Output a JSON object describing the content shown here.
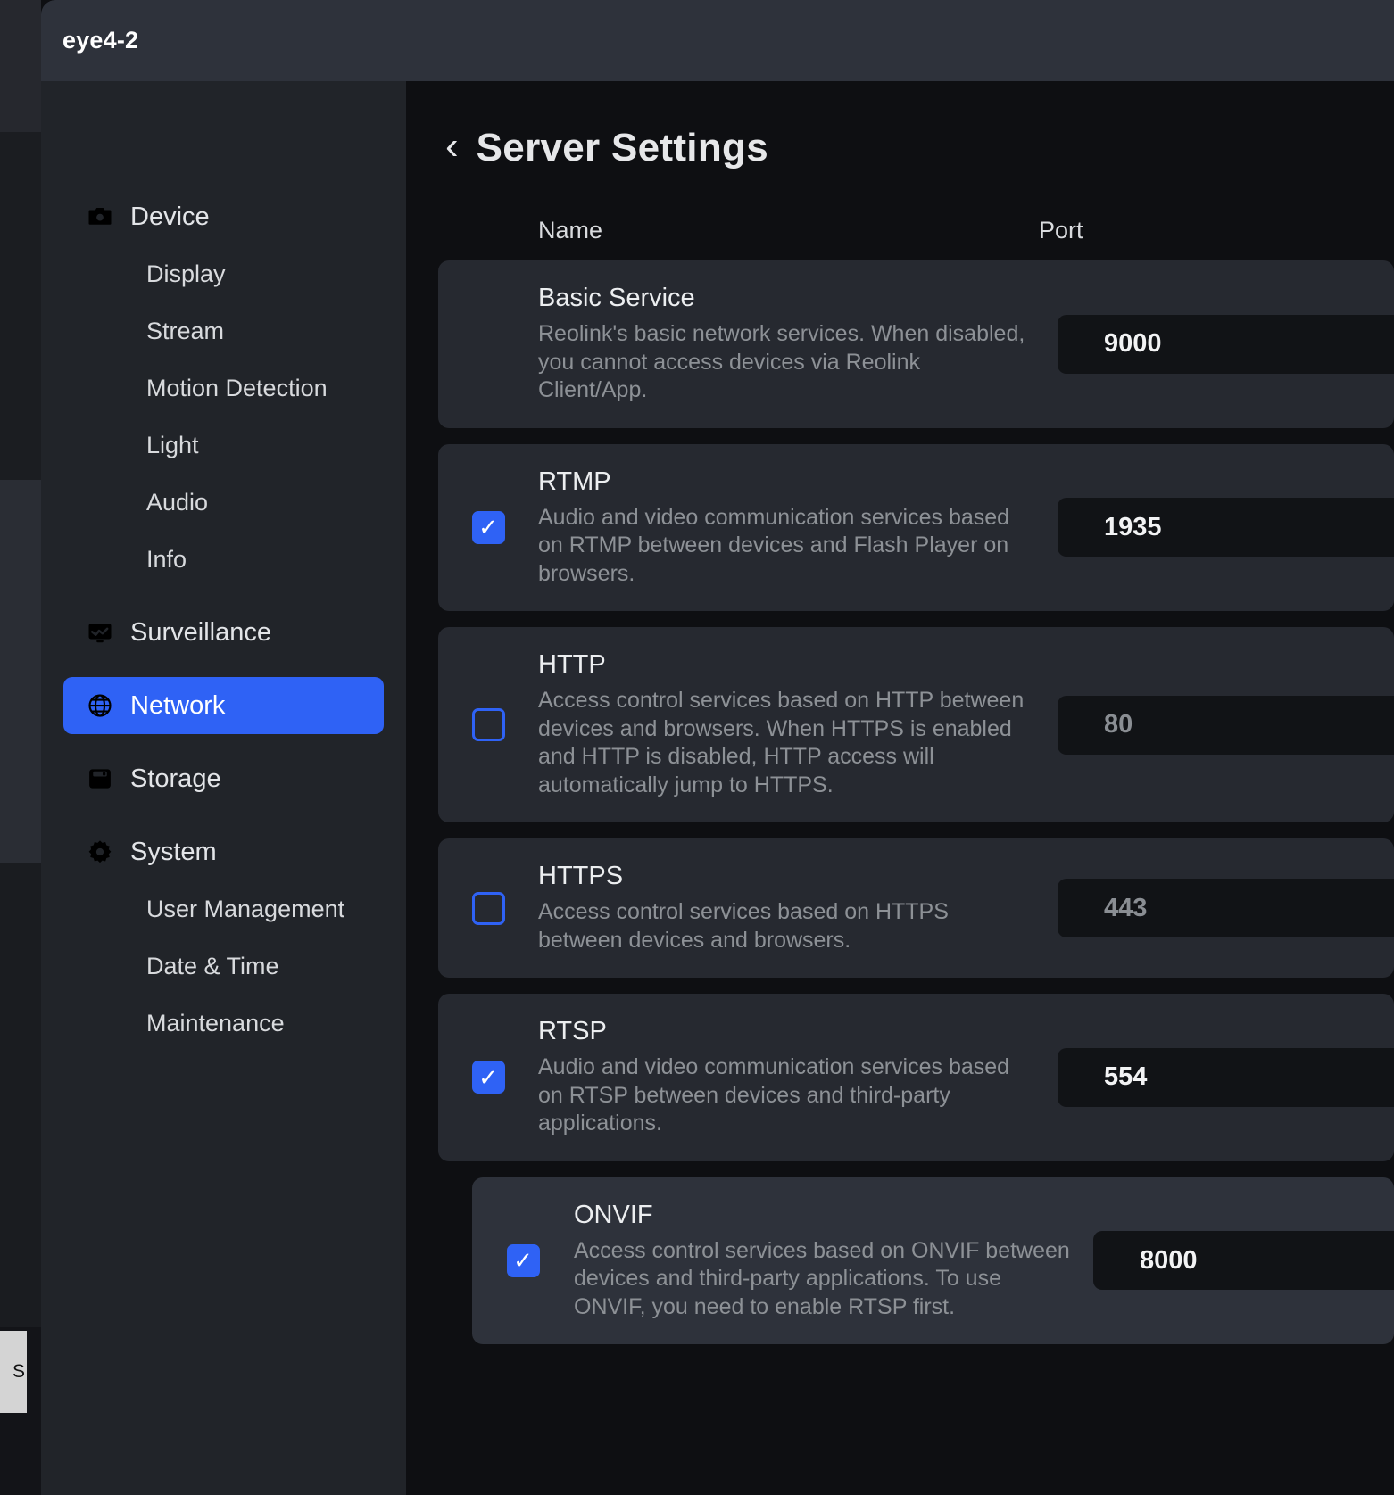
{
  "backdrop": {
    "taskbar_chip_label": "S"
  },
  "window": {
    "title": "eye4-2"
  },
  "sidebar": {
    "groups": [
      {
        "type": "top",
        "label": "Device",
        "icon": "camera-icon",
        "active": false,
        "name": "sidebar-item-device"
      },
      {
        "type": "sub",
        "label": "Display",
        "name": "sidebar-item-display"
      },
      {
        "type": "sub",
        "label": "Stream",
        "name": "sidebar-item-stream"
      },
      {
        "type": "sub",
        "label": "Motion Detection",
        "name": "sidebar-item-motion-detection"
      },
      {
        "type": "sub",
        "label": "Light",
        "name": "sidebar-item-light"
      },
      {
        "type": "sub",
        "label": "Audio",
        "name": "sidebar-item-audio"
      },
      {
        "type": "sub",
        "label": "Info",
        "name": "sidebar-item-info"
      },
      {
        "type": "top",
        "label": "Surveillance",
        "icon": "monitor-icon",
        "active": false,
        "name": "sidebar-item-surveillance"
      },
      {
        "type": "top",
        "label": "Network",
        "icon": "globe-icon",
        "active": true,
        "name": "sidebar-item-network"
      },
      {
        "type": "top",
        "label": "Storage",
        "icon": "disk-icon",
        "active": false,
        "name": "sidebar-item-storage"
      },
      {
        "type": "top",
        "label": "System",
        "icon": "gear-icon",
        "active": false,
        "name": "sidebar-item-system"
      },
      {
        "type": "sub",
        "label": "User Management",
        "name": "sidebar-item-user-management"
      },
      {
        "type": "sub",
        "label": "Date & Time",
        "name": "sidebar-item-date-time"
      },
      {
        "type": "sub",
        "label": "Maintenance",
        "name": "sidebar-item-maintenance"
      }
    ]
  },
  "page": {
    "back_icon": "‹",
    "title": "Server Settings",
    "columns": {
      "name": "Name",
      "port": "Port"
    }
  },
  "services": [
    {
      "name": "Basic Service",
      "description": "Reolink's basic network services. When disabled, you cannot access devices via Reolink Client/App.",
      "has_checkbox": false,
      "checked": false,
      "port": "9000",
      "port_enabled": true,
      "nested": false
    },
    {
      "name": "RTMP",
      "description": "Audio and video communication services based on RTMP between devices and Flash Player on browsers.",
      "has_checkbox": true,
      "checked": true,
      "port": "1935",
      "port_enabled": true,
      "nested": false
    },
    {
      "name": "HTTP",
      "description": "Access control services based on HTTP between devices and browsers. When HTTPS is enabled and HTTP is disabled, HTTP access will automatically jump to HTTPS.",
      "has_checkbox": true,
      "checked": false,
      "port": "80",
      "port_enabled": false,
      "nested": false
    },
    {
      "name": "HTTPS",
      "description": "Access control services based on HTTPS between devices and browsers.",
      "has_checkbox": true,
      "checked": false,
      "port": "443",
      "port_enabled": false,
      "nested": false
    },
    {
      "name": "RTSP",
      "description": "Audio and video communication services based on RTSP between devices and third-party applications.",
      "has_checkbox": true,
      "checked": true,
      "port": "554",
      "port_enabled": true,
      "nested": false
    },
    {
      "name": "ONVIF",
      "description": "Access control services based on ONVIF between devices and third-party applications. To use ONVIF, you need to enable RTSP first.",
      "has_checkbox": true,
      "checked": true,
      "port": "8000",
      "port_enabled": true,
      "nested": true
    }
  ],
  "colors": {
    "accent": "#2f62f5",
    "window_chrome": "#2e323b",
    "sidebar_bg": "#212429",
    "content_bg": "#0e0f12",
    "card_bg": "#262930",
    "card_nested_bg": "#2e323b",
    "input_bg": "#111316",
    "text_primary": "#eceef0",
    "text_muted": "#8d9196"
  },
  "icon_glyphs": {
    "checkmark": "✓"
  }
}
